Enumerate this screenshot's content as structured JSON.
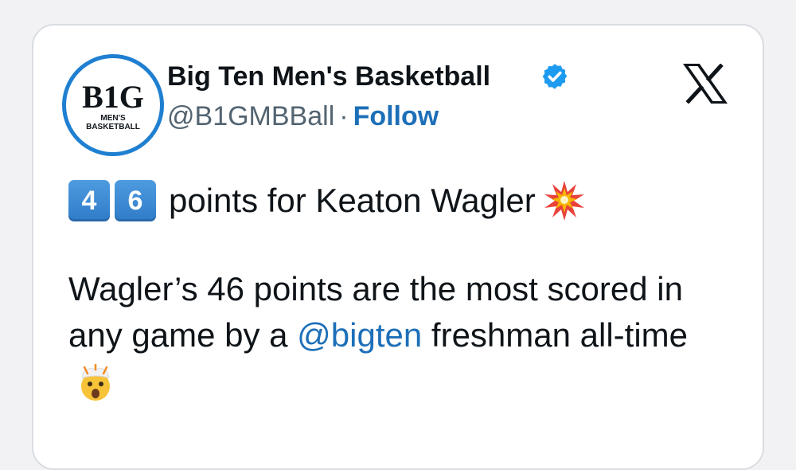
{
  "tweet": {
    "author": {
      "avatar_text": "B1G",
      "avatar_subtext_1": "MEN'S",
      "avatar_subtext_2": "BASKETBALL",
      "display_name": "Big Ten Men's Basketball",
      "verified": true,
      "handle": "@B1GMBBall",
      "separator": "·",
      "follow_label": "Follow"
    },
    "platform_icon": "x-logo-icon",
    "headline": {
      "keycap_1": "4",
      "keycap_2": "6",
      "text": "points for Keaton Wagler",
      "emoji_icon": "collision-burst-icon"
    },
    "body": {
      "part1": "Wagler’s 46 points are the most scored in any game by a ",
      "mention": "@bigten",
      "part2": " freshman all-time",
      "emoji_icon": "exploding-head-icon"
    }
  },
  "colors": {
    "link": "#1d6fb8",
    "text": "#0f1419",
    "muted": "#536471",
    "verified": "#1d9bf0",
    "avatar_ring": "#1f7fd1",
    "keycap": "#3b86d3"
  }
}
